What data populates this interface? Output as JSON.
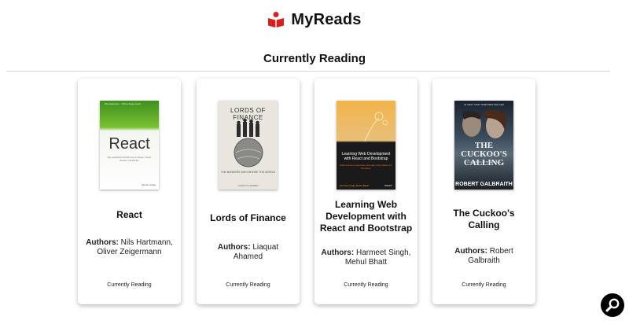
{
  "header": {
    "app_title": "MyReads"
  },
  "shelf": {
    "title": "Currently Reading",
    "books": [
      {
        "title": "React",
        "authors_label": "Authors:",
        "authors": "Nils Hartmann, Oliver Zeigermann",
        "shelf": "Currently Reading",
        "cover": {
          "wordmark": "React",
          "authors_line": "Nils Hartmann · Oliver Zeigermann",
          "subtitle": "Die praktische Einführung in React, React Router und Redux",
          "publisher": "dpunkt.verlag"
        }
      },
      {
        "title": "Lords of Finance",
        "authors_label": "Authors:",
        "authors": "Liaquat Ahamed",
        "shelf": "Currently Reading",
        "cover": {
          "wordmark": "LORDS OF FINANCE",
          "subtitle": "THE BANKERS WHO BROKE THE WORLD",
          "author": "LIAQUAT AHAMED"
        }
      },
      {
        "title": "Learning Web Development with React and Bootstrap",
        "authors_label": "Authors:",
        "authors": "Harmeet Singh, Mehul Bhatt",
        "shelf": "Currently Reading",
        "cover": {
          "wordmark": "Learning Web Development with React and Bootstrap",
          "subtitle": "Build real-time responsive web apps using React and Bootstrap",
          "authors_line": "Harmeet Singh  Mehul Bhatt",
          "publisher": "PACKT"
        }
      },
      {
        "title": "The Cuckoo's Calling",
        "authors_label": "Authors:",
        "authors": "Robert Galbraith",
        "shelf": "Currently Reading",
        "cover": {
          "top_line": "#1 NEW YORK TIMES BESTSELLER",
          "wordmark": "THE CUCKOO'S CALLING",
          "subtitle": "A CORMORAN STRIKE NOVEL",
          "author": "ROBERT GALBRAITH"
        }
      }
    ]
  },
  "colors": {
    "logo_red": "#d9201f",
    "fab_background": "#000000"
  }
}
